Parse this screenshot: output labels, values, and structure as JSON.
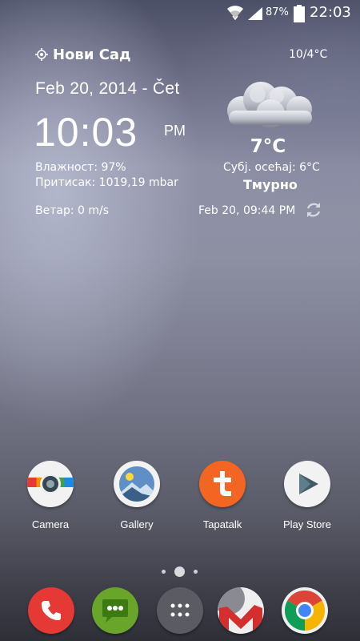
{
  "status_bar": {
    "battery_percent": "87%",
    "time": "22:03",
    "icons": [
      "wifi-icon",
      "signal-icon",
      "battery-icon"
    ]
  },
  "weather": {
    "location": "Нови Сад",
    "hi_lo": "10/4°C",
    "date": "Feb 20, 2014 - Čet",
    "time": "10:03",
    "ampm": "PM",
    "humidity": "Влажност: 97%",
    "pressure": "Притисак: 1019,19 mbar",
    "wind": "Ветар: 0 m/s",
    "temperature": "7°C",
    "feels_like": "Субј. осећај: 6°C",
    "condition": "Тмурно",
    "updated": "Feb 20, 09:44 PM",
    "icon": "cloud-icon"
  },
  "apps": [
    {
      "label": "Camera",
      "icon": "camera-icon"
    },
    {
      "label": "Gallery",
      "icon": "gallery-icon"
    },
    {
      "label": "Tapatalk",
      "icon": "tapatalk-icon"
    },
    {
      "label": "Play Store",
      "icon": "play-store-icon"
    }
  ],
  "pager": {
    "page_count": 3,
    "current_page": 2
  },
  "dock": [
    "phone-icon",
    "messaging-icon",
    "app-drawer-icon",
    "email-icon",
    "chrome-icon"
  ],
  "colors": {
    "phone": "#e53935",
    "messaging": "#6aa52b",
    "tapatalk": "#f26522",
    "text": "#ffffff"
  }
}
